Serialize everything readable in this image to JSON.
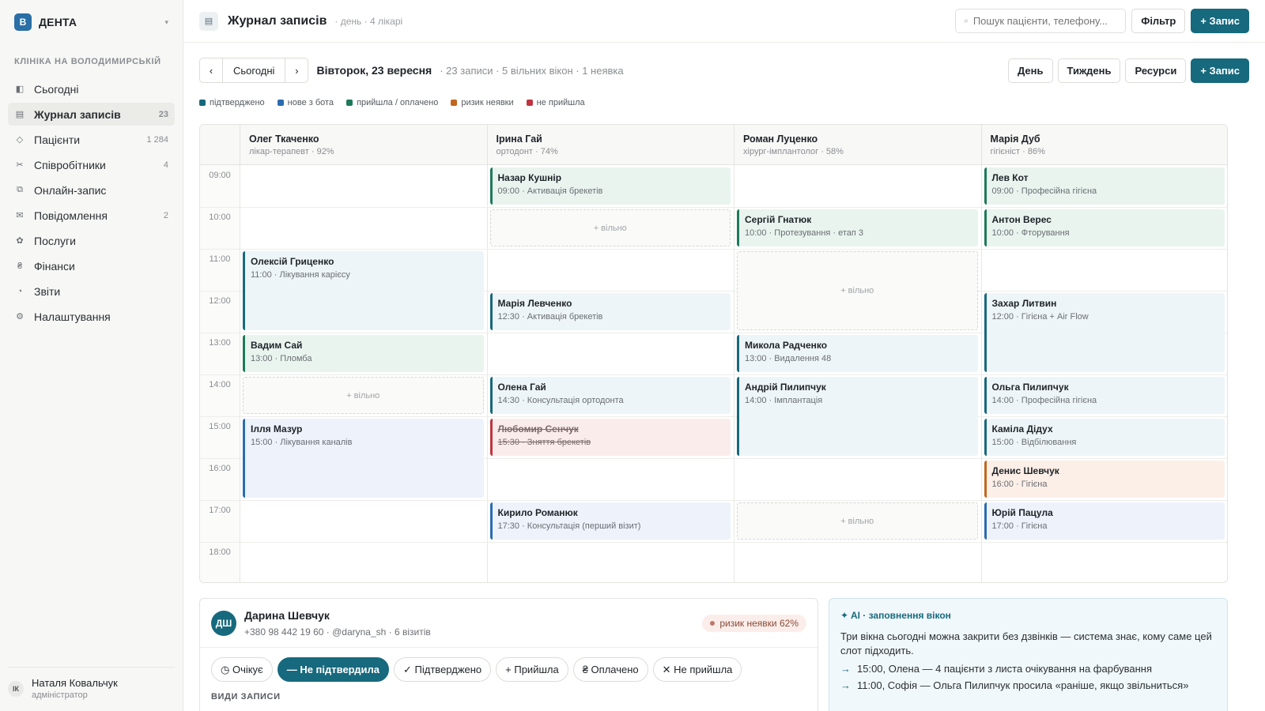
{
  "sidebar": {
    "logo": "В",
    "brand": "ДЕНТА",
    "caret": "▾",
    "clinic": "КЛІНІКА НА ВОЛОДИМИРСЬКІЙ",
    "items": [
      {
        "label": "Сьогодні",
        "icon": "◧",
        "count": ""
      },
      {
        "label": "Журнал записів",
        "icon": "▤",
        "count": "23"
      },
      {
        "label": "Пацієнти",
        "icon": "◇",
        "count": "1 284"
      },
      {
        "label": "Співробітники",
        "icon": "✂",
        "count": "4"
      },
      {
        "label": "Онлайн-запис",
        "icon": "⧉",
        "count": ""
      },
      {
        "label": "Повідомлення",
        "icon": "✉",
        "count": "2"
      },
      {
        "label": "Послуги",
        "icon": "✿",
        "count": ""
      },
      {
        "label": "Фінанси",
        "icon": "₴",
        "count": ""
      },
      {
        "label": "Звіти",
        "icon": "◔",
        "count": ""
      },
      {
        "label": "Налаштування",
        "icon": "⚙",
        "count": ""
      }
    ],
    "user": {
      "initials": "ІК",
      "name": "Наталя Ковальчук",
      "role": "адміністратор"
    }
  },
  "topbar": {
    "icon": "▤",
    "title": "Журнал записів",
    "subtitle": "· день · 4 лікарі",
    "search_placeholder": "Пошук пацієнти, телефону...",
    "filter": "Фільтр",
    "add": "+ Запис"
  },
  "toolbar": {
    "prev": "‹",
    "today": "Сьогодні",
    "next": "›",
    "date": "Вівторок, 23 вересня",
    "stats": "· 23 записи · 5 вільних вікон · 1 неявка",
    "views": [
      "День",
      "Тиждень",
      "Ресурси"
    ],
    "add": "+ Запис"
  },
  "legend": [
    {
      "label": "підтверджено",
      "color": "#17697d"
    },
    {
      "label": "нове з бота",
      "color": "#2b6cb0"
    },
    {
      "label": "прийшла / оплачено",
      "color": "#1d7a5a"
    },
    {
      "label": "ризик неявки",
      "color": "#c2671d"
    },
    {
      "label": "не прийшла",
      "color": "#c0343f"
    }
  ],
  "schedule": {
    "times": [
      "09:00",
      "10:00",
      "11:00",
      "12:00",
      "13:00",
      "14:00",
      "15:00",
      "16:00",
      "17:00",
      "18:00"
    ],
    "doctors": [
      {
        "name": "Олег Ткаченко",
        "role": "лікар-терапевт · 92%"
      },
      {
        "name": "Ірина Гай",
        "role": "ортодонт · 74%"
      },
      {
        "name": "Роман Луценко",
        "role": "хірург-імплантолог · 58%"
      },
      {
        "name": "Марія Дуб",
        "role": "гігієніст · 86%"
      }
    ],
    "free_label": "+ вільно",
    "events": [
      {
        "col": 0,
        "start": 2,
        "dur": 2,
        "name": "Олексій Гриценко",
        "desc": "11:00 · Лікування карієсу",
        "kind": "teal"
      },
      {
        "col": 0,
        "start": 4,
        "dur": 1,
        "name": "Вадим Сай",
        "desc": "13:00 · Пломба",
        "kind": "green"
      },
      {
        "col": 0,
        "start": 6,
        "dur": 2,
        "name": "Ілля Мазур",
        "desc": "15:00 · Лікування каналів",
        "kind": "blue"
      },
      {
        "col": 1,
        "start": 0,
        "dur": 1,
        "name": "Назар Кушнір",
        "desc": "09:00 · Активація брекетів",
        "kind": "green"
      },
      {
        "col": 1,
        "start": 3,
        "dur": 1,
        "name": "Марія Левченко",
        "desc": "12:30 · Активація брекетів",
        "kind": "teal"
      },
      {
        "col": 1,
        "start": 5,
        "dur": 1,
        "name": "Олена Гай",
        "desc": "14:30 · Консультація ортодонта",
        "kind": "teal"
      },
      {
        "col": 1,
        "start": 6,
        "dur": 1,
        "name": "Любомир Сенчук",
        "desc": "15:30 · Зняття брекетів",
        "kind": "red"
      },
      {
        "col": 1,
        "start": 8,
        "dur": 1,
        "name": "Кирило Романюк",
        "desc": "17:30 · Консультація (перший візит)",
        "kind": "blue"
      },
      {
        "col": 2,
        "start": 1,
        "dur": 1,
        "name": "Сергій Гнатюк",
        "desc": "10:00 · Протезування · етап 3",
        "kind": "green"
      },
      {
        "col": 2,
        "start": 4,
        "dur": 1,
        "name": "Микола Радченко",
        "desc": "13:00 · Видалення 48",
        "kind": "teal"
      },
      {
        "col": 2,
        "start": 5,
        "dur": 2,
        "name": "Андрій Пилипчук",
        "desc": "14:00 · Імплантація",
        "kind": "teal"
      },
      {
        "col": 3,
        "start": 0,
        "dur": 1,
        "name": "Лев Кот",
        "desc": "09:00 · Професійна гігієна",
        "kind": "green"
      },
      {
        "col": 3,
        "start": 1,
        "dur": 1,
        "name": "Антон Верес",
        "desc": "10:00 · Фторування",
        "kind": "green"
      },
      {
        "col": 3,
        "start": 3,
        "dur": 2,
        "name": "Захар Литвин",
        "desc": "12:00 · Гігієна + Air Flow",
        "kind": "teal"
      },
      {
        "col": 3,
        "start": 5,
        "dur": 1,
        "name": "Ольга Пилипчук",
        "desc": "14:00 · Професійна гігієна",
        "kind": "teal"
      },
      {
        "col": 3,
        "start": 6,
        "dur": 1,
        "name": "Каміла Дідух",
        "desc": "15:00 · Відбілювання",
        "kind": "teal"
      },
      {
        "col": 3,
        "start": 7,
        "dur": 1,
        "name": "Денис Шевчук",
        "desc": "16:00 · Гігієна",
        "kind": "orange"
      },
      {
        "col": 3,
        "start": 8,
        "dur": 1,
        "name": "Юрій Пацула",
        "desc": "17:00 · Гігієна",
        "kind": "blue"
      }
    ],
    "free_slots": [
      {
        "col": 1,
        "start": 1,
        "dur": 1
      },
      {
        "col": 2,
        "start": 2,
        "dur": 2
      },
      {
        "col": 0,
        "start": 5,
        "dur": 1
      },
      {
        "col": 2,
        "start": 8,
        "dur": 1
      }
    ]
  },
  "patient": {
    "initials": "ДШ",
    "name": "Дарина Шевчук",
    "meta": "+380 98 442 19 60 · @daryna_sh · 6 візитів",
    "risk": "ризик неявки 62%",
    "statuses": [
      {
        "label": "◷ Очікує",
        "active": false
      },
      {
        "label": "— Не підтвердила",
        "active": true
      },
      {
        "label": "✓ Підтверджено",
        "active": false
      },
      {
        "label": "+ Прийшла",
        "active": false
      },
      {
        "label": "₴ Оплачено",
        "active": false
      },
      {
        "label": "✕ Не прийшла",
        "active": false
      }
    ],
    "section": "ВИДИ ЗАПИСИ"
  },
  "ai": {
    "title": "✦ AI · заповнення вікон",
    "text": "Три вікна сьогодні можна закрити без дзвінків — система знає, кому саме цей слот підходить.",
    "suggestions": [
      "15:00, Олена — 4 пацієнти з листа очікування на фарбування",
      "11:00, Софія — Ольга Пилипчук просила «раніше, якщо звільниться»"
    ]
  }
}
